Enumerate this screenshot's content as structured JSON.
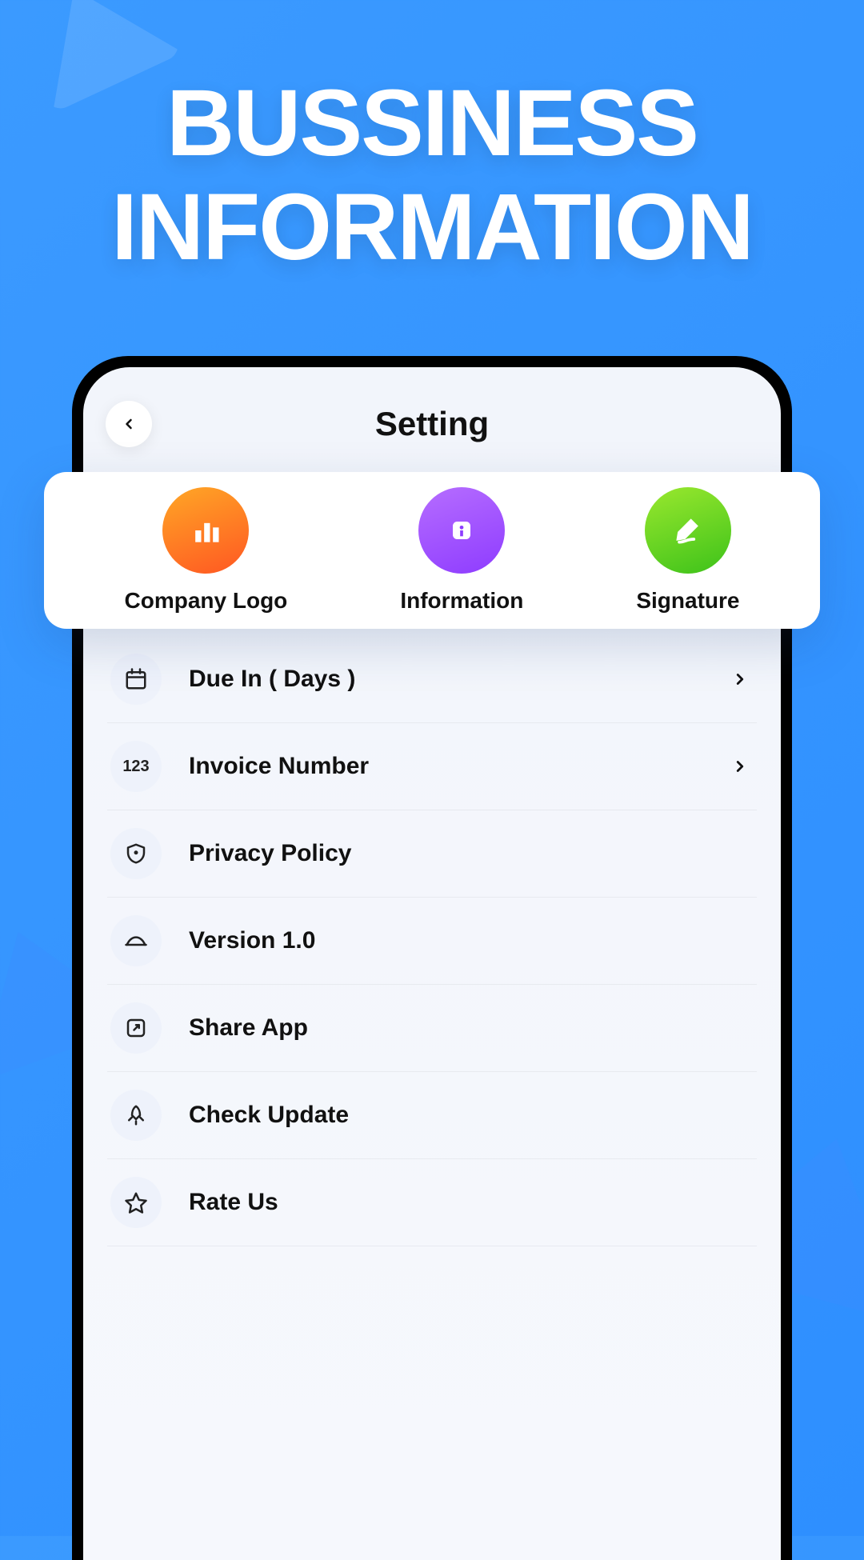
{
  "hero": {
    "line1": "BUSSINESS",
    "line2": "INFORMATION"
  },
  "header": {
    "title": "Setting"
  },
  "tiles": [
    {
      "label": "Company Logo",
      "color": "orange",
      "icon": "chart"
    },
    {
      "label": "Information",
      "color": "purple",
      "icon": "info"
    },
    {
      "label": "Signature",
      "color": "green",
      "icon": "pen"
    }
  ],
  "rows": [
    {
      "label": "Due In ( Days )",
      "icon": "calendar",
      "chevron": true
    },
    {
      "label": "Invoice Number",
      "icon": "123",
      "chevron": true
    },
    {
      "label": "Privacy Policy",
      "icon": "shield",
      "chevron": false
    },
    {
      "label": "Version 1.0",
      "icon": "curve",
      "chevron": false
    },
    {
      "label": "Share App",
      "icon": "share",
      "chevron": false
    },
    {
      "label": "Check Update",
      "icon": "rocket",
      "chevron": false
    },
    {
      "label": "Rate Us",
      "icon": "star",
      "chevron": false
    }
  ],
  "icon_text": {
    "123": "123"
  }
}
